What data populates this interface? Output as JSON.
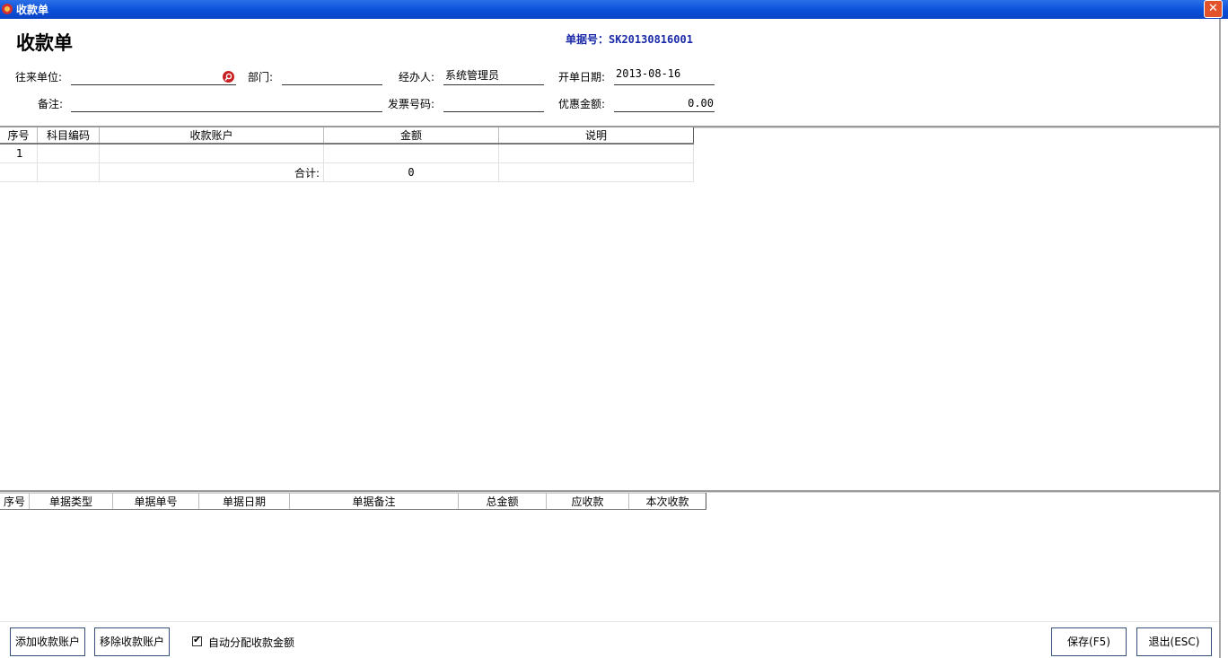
{
  "window": {
    "title": "收款单",
    "close_glyph": "✕"
  },
  "form": {
    "heading": "收款单",
    "doc_no": "单据号：SK20130816001",
    "partner_label": "往来单位:",
    "partner_value": "",
    "dept_label": "部门:",
    "dept_value": "",
    "handler_label": "经办人:",
    "handler_value": "系统管理员",
    "date_label": "开单日期:",
    "date_value": "2013-08-16",
    "remark_label": "备注:",
    "remark_value": "",
    "invoice_label": "发票号码:",
    "invoice_value": "",
    "discount_label": "优惠金额:",
    "discount_value": "0.00"
  },
  "accounts_table": {
    "columns": [
      "序号",
      "科目编码",
      "收款账户",
      "金额",
      "说明"
    ],
    "rows": [
      [
        "1",
        "",
        "",
        "",
        ""
      ]
    ],
    "total_label": "合计:",
    "total_value": "0"
  },
  "bills_table": {
    "columns": [
      "序号",
      "单据类型",
      "单据单号",
      "单据日期",
      "单据备注",
      "总金额",
      "应收款",
      "本次收款"
    ]
  },
  "footer": {
    "add_account": "添加收款账户",
    "remove_account": "移除收款账户",
    "auto_alloc_label": "自动分配收款金额",
    "auto_alloc_checked": "✔",
    "save": "保存(F5)",
    "exit": "退出(ESC)"
  },
  "icons": {
    "app": "app-icon",
    "search": "search-icon",
    "close": "close-icon"
  },
  "colors": {
    "titlebar": "#0a4fd8",
    "doc_no": "#1a2aa8",
    "close": "#e2532b"
  }
}
